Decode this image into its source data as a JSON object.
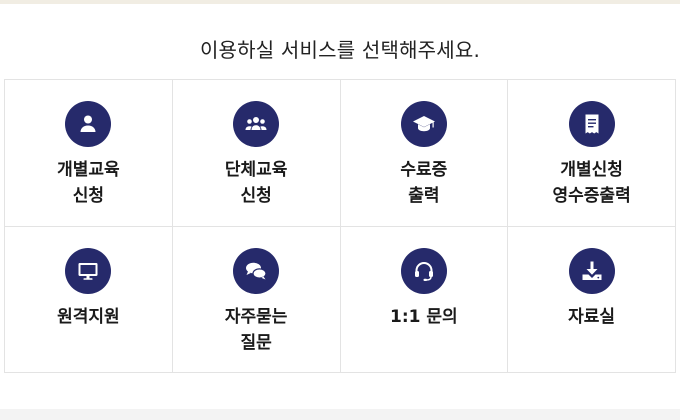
{
  "heading": "이용하실 서비스를 선택해주세요.",
  "services": [
    {
      "icon": "person-icon",
      "lines": [
        "개별교육",
        "신청"
      ]
    },
    {
      "icon": "group-icon",
      "lines": [
        "단체교육",
        "신청"
      ]
    },
    {
      "icon": "graduation-cap-icon",
      "lines": [
        "수료증",
        "출력"
      ]
    },
    {
      "icon": "receipt-icon",
      "lines": [
        "개별신청",
        "영수증출력"
      ]
    },
    {
      "icon": "monitor-icon",
      "lines": [
        "원격지원"
      ]
    },
    {
      "icon": "chat-bubbles-icon",
      "lines": [
        "자주묻는",
        "질문"
      ]
    },
    {
      "icon": "headset-icon",
      "lines": [
        "1:1 문의"
      ]
    },
    {
      "icon": "download-icon",
      "lines": [
        "자료실"
      ]
    }
  ],
  "colors": {
    "icon_bg": "#262a6b",
    "icon_fg": "#ffffff",
    "text": "#1a1a1a"
  }
}
